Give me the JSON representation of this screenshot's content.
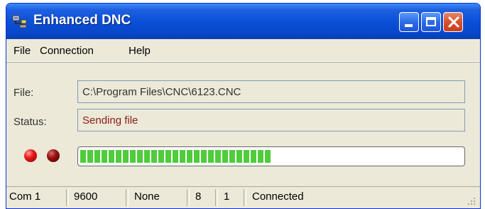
{
  "window": {
    "title": "Enhanced DNC",
    "icon": "plug-cable-icon"
  },
  "caption_buttons": {
    "minimize": "minimize-icon",
    "maximize": "maximize-icon",
    "close": "close-icon"
  },
  "menu": {
    "file": "File",
    "connection": "Connection",
    "help": "Help"
  },
  "fields": {
    "file_label": "File:",
    "file_value": "C:\\Program Files\\CNC\\6123.CNC",
    "status_label": "Status:",
    "status_value": "Sending file"
  },
  "indicators": {
    "led_colors": [
      "#e81818",
      "#9a1010"
    ]
  },
  "progress": {
    "fraction": 0.5,
    "color": "#4fcc3a"
  },
  "statusbar": {
    "port": "Com 1",
    "baud": "9600",
    "parity": "None",
    "databits": "8",
    "stopbits": "1",
    "state": "Connected"
  }
}
